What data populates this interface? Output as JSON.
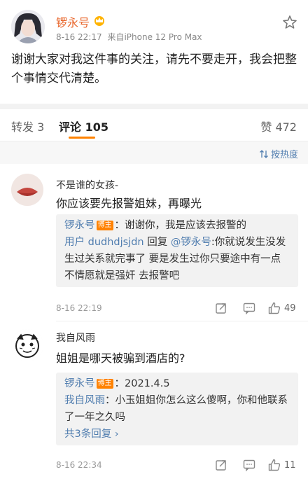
{
  "post": {
    "author": "锣永号",
    "time": "8-16 22:17",
    "source": "来自iPhone 12 Pro Max",
    "text": "谢谢大家对我这件事的关注，请先不要走开，我会把整个事情交代清楚。"
  },
  "tabs": {
    "repost": "转发 3",
    "comment": "评论 105",
    "like": "赞 472"
  },
  "sort_label": "按热度",
  "comments": [
    {
      "name": "不是谁的女孩-",
      "text": "你应该要先报警姐妹，再曝光",
      "replies": [
        {
          "who": "锣永号",
          "badge": "博主",
          "text": "：谢谢你，我是应该去报警的"
        },
        {
          "who": "用户 dudhdjsjdn",
          "mid": " 回复 ",
          "who2": "@锣永号",
          "text": ":你就说发生没发生过关系就完事了 要是发生过你只要途中有一点不情愿就是强奸 去报警吧"
        }
      ],
      "time": "8-16 22:19",
      "likes": "49"
    },
    {
      "name": "我自风雨",
      "text": "姐姐是哪天被骗到酒店的?",
      "replies": [
        {
          "who": "锣永号",
          "badge": "博主",
          "text": "：2021.4.5"
        },
        {
          "who": "我自风雨",
          "text": "：小玉姐姐你怎么这么傻啊，你和他联系了一年之久吗"
        }
      ],
      "more": "共3条回复 ›",
      "time": "8-16 22:34",
      "likes": "11"
    }
  ],
  "colors": {
    "accent": "#ff8200",
    "link": "#507daf",
    "name": "#e8652a"
  }
}
